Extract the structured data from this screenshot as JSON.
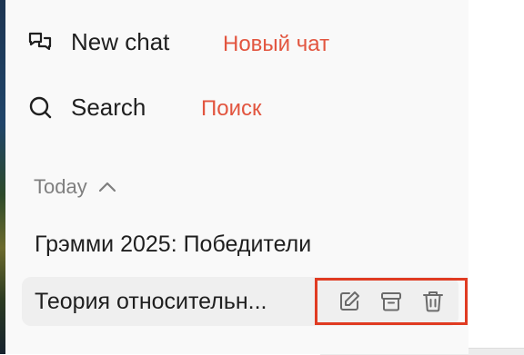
{
  "sidebar": {
    "new_chat": {
      "icon": "new-chat-icon",
      "label": "New chat",
      "translation": "Новый чат"
    },
    "search": {
      "icon": "search-icon",
      "label": "Search",
      "translation": "Поиск"
    },
    "section": {
      "label": "Today",
      "icon": "chevron-up-icon"
    },
    "chats": [
      {
        "title": "Грэмми 2025: Победители"
      },
      {
        "title": "Теория относительн..."
      }
    ],
    "chat_actions": [
      {
        "icon": "edit-icon"
      },
      {
        "icon": "archive-icon"
      },
      {
        "icon": "trash-icon"
      }
    ]
  },
  "colors": {
    "sidebar_bg": "#f9f9f9",
    "annotation": "#e2553f",
    "highlight_border": "#e03b22"
  }
}
